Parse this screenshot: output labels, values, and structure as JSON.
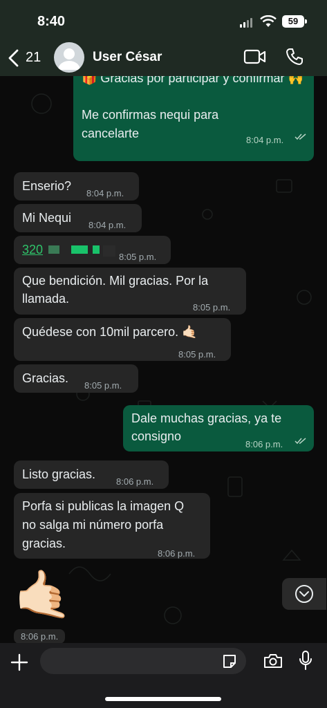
{
  "status_bar": {
    "time": "8:40",
    "battery": "59"
  },
  "header": {
    "back_count": "21",
    "contact_name": "User César"
  },
  "messages": [
    {
      "dir": "out",
      "text": "🎁 Gracias por participar y confirmar 🙌",
      "text2": "Me confirmas nequi para cancelarte",
      "time": "8:04 p.m."
    },
    {
      "dir": "in",
      "text": "Enserio?",
      "time": "8:04 p.m."
    },
    {
      "dir": "in",
      "text": "Mi Nequi",
      "time": "8:04 p.m."
    },
    {
      "dir": "in",
      "text": "320",
      "time": "8:05 p.m."
    },
    {
      "dir": "in",
      "text": "Que bendición. Mil gracias. Por la llamada.",
      "time": "8:05 p.m."
    },
    {
      "dir": "in",
      "text": "Quédese con 10mil parcero. 🤙🏻",
      "time": "8:05 p.m."
    },
    {
      "dir": "in",
      "text": "Gracias.",
      "time": "8:05 p.m."
    },
    {
      "dir": "out",
      "text": "Dale muchas gracias, ya te consigno",
      "time": "8:06 p.m."
    },
    {
      "dir": "in",
      "text": "Listo gracias.",
      "time": "8:06 p.m."
    },
    {
      "dir": "in",
      "text": "Porfa si publicas la imagen Q no salga mi número porfa gracias.",
      "time": "8:06 p.m."
    },
    {
      "dir": "in",
      "text": "🤙🏻",
      "time": "8:06 p.m."
    }
  ],
  "colors": {
    "outgoing": "#0a5a3e",
    "incoming": "#262626",
    "header": "#1f2a23"
  }
}
